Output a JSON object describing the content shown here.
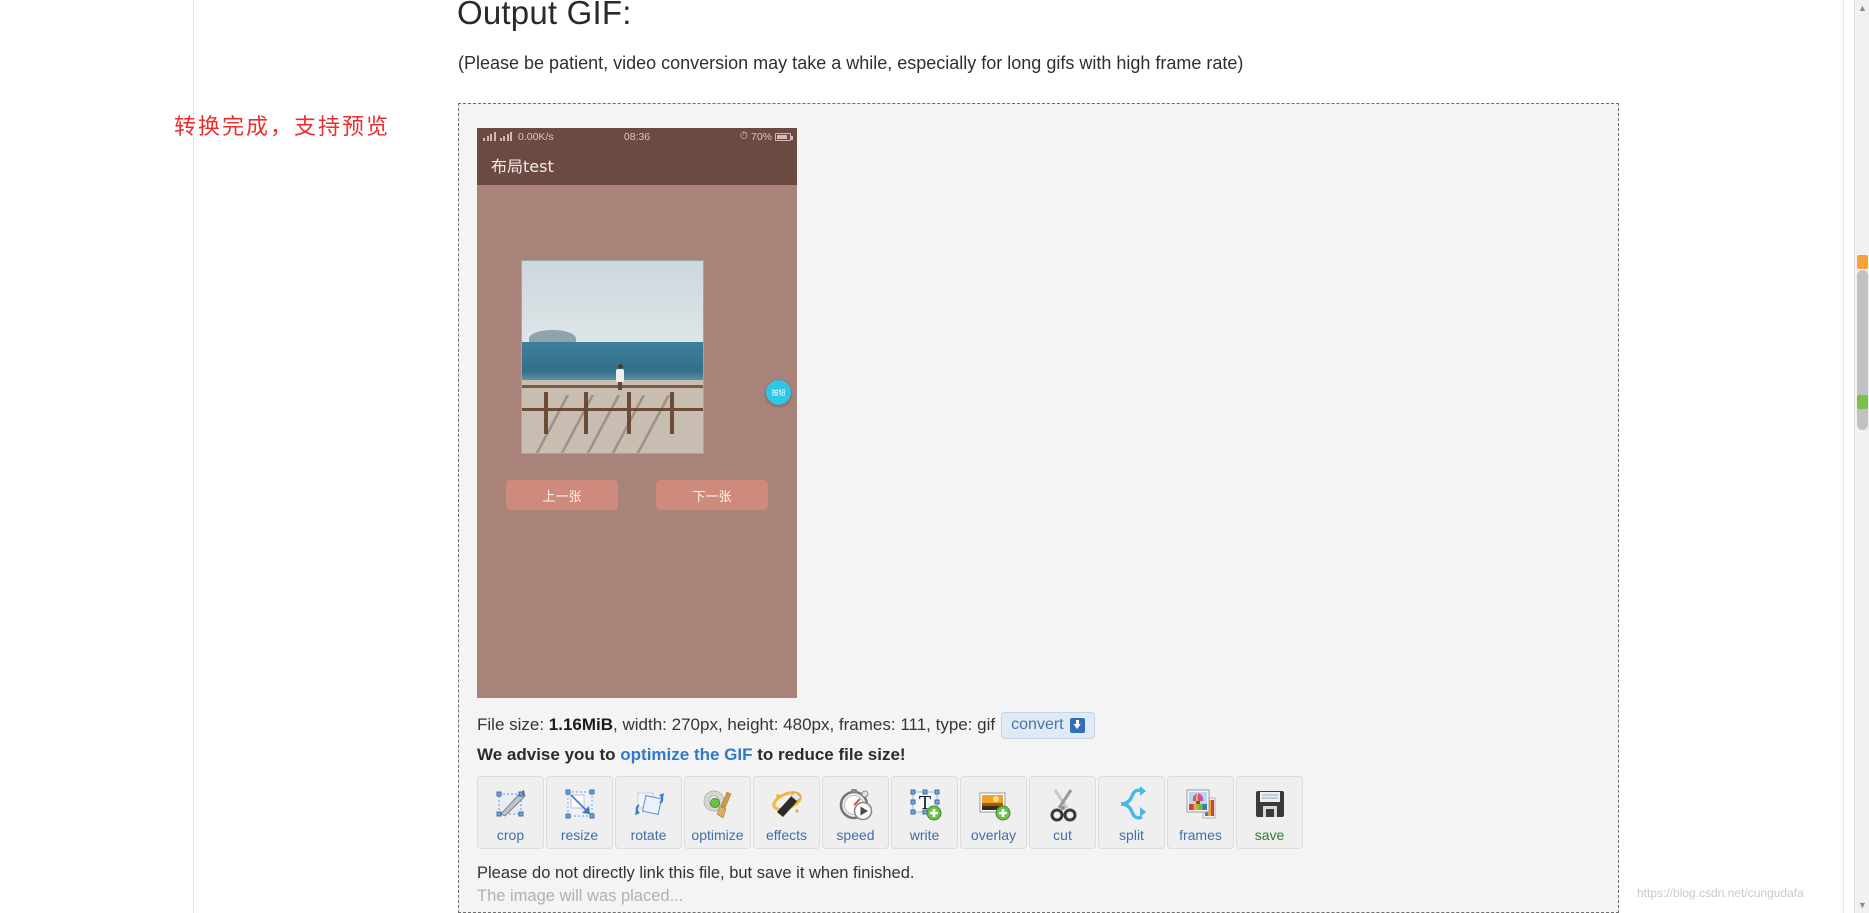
{
  "page": {
    "heading": "Output GIF:",
    "subnote": "(Please be patient, video conversion may take a while, especially for long gifs with high frame rate)",
    "annotation_red": "转换完成，支持预览",
    "watermark": "https://blog.csdn.net/cungudafa"
  },
  "preview": {
    "status_bar": {
      "speed": "0.00K/s",
      "time": "08:36",
      "battery_text": "70%",
      "signal_icon": "signal-bars-icon",
      "wifi_icon": "wifi-icon",
      "alarm_icon": "alarm-icon",
      "battery_icon": "battery-icon"
    },
    "app_title": "布局test",
    "fab_label": "按钮",
    "buttons": [
      {
        "label": "上一张",
        "name": "prev-image-button"
      },
      {
        "label": "下一张",
        "name": "next-image-button"
      }
    ]
  },
  "file_info": {
    "prefix": "File size: ",
    "size": "1.16MiB",
    "rest": ", width: 270px, height: 480px, frames: 111, type: gif",
    "convert_label": "convert",
    "convert_icon": "download-icon"
  },
  "advise": {
    "before": "We advise you to ",
    "link": "optimize the GIF",
    "after": " to reduce file size!"
  },
  "tools": [
    {
      "label": "crop",
      "icon": "crop-icon"
    },
    {
      "label": "resize",
      "icon": "resize-icon"
    },
    {
      "label": "rotate",
      "icon": "rotate-icon"
    },
    {
      "label": "optimize",
      "icon": "optimize-broom-icon"
    },
    {
      "label": "effects",
      "icon": "magic-wand-icon"
    },
    {
      "label": "speed",
      "icon": "stopwatch-play-icon"
    },
    {
      "label": "write",
      "icon": "text-add-icon"
    },
    {
      "label": "overlay",
      "icon": "image-add-icon"
    },
    {
      "label": "cut",
      "icon": "scissors-icon"
    },
    {
      "label": "split",
      "icon": "split-arrows-icon"
    },
    {
      "label": "frames",
      "icon": "frames-stack-icon"
    },
    {
      "label": "save",
      "icon": "floppy-disk-icon"
    }
  ],
  "footer": {
    "line1": "Please do not directly link this file, but save it when finished.",
    "line2": "The image will was placed..."
  },
  "colors": {
    "link": "#2f79c9",
    "annotation_red": "#ec2d2d",
    "phone_bg": "#a9827a",
    "phone_bar": "#6b4a41",
    "phone_button": "#cd8a7d",
    "fab": "#2ec7e6",
    "save_label": "#2f7a2f"
  },
  "scrollbar": {
    "up_arrow": "▲",
    "down_arrow": "▼"
  }
}
